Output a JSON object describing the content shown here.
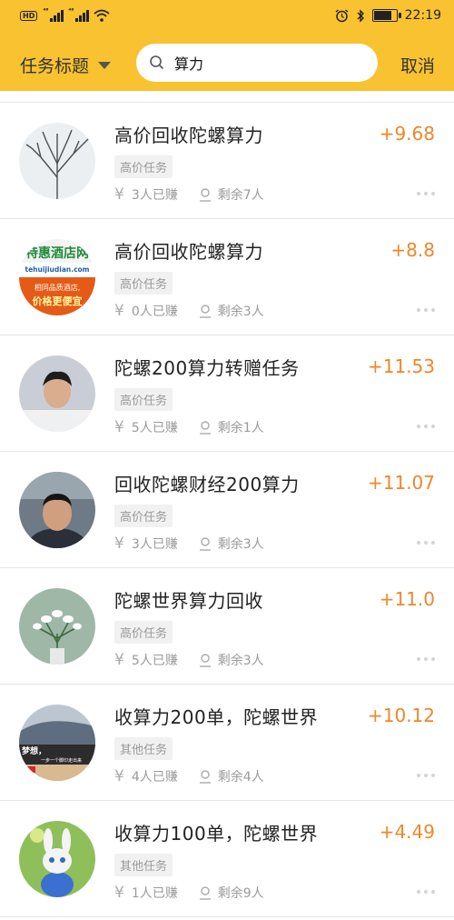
{
  "statusbar": {
    "left_icons": [
      "hd-icon",
      "signal-icon",
      "signal-icon",
      "wifi-icon"
    ],
    "time": "22:19",
    "signal1": "⁴⁶",
    "signal2": "⁴⁶",
    "hd": "HD"
  },
  "header": {
    "filter_label": "任务标题",
    "search_value": "算力",
    "cancel_label": "取消",
    "accent": "#f8c230"
  },
  "tasks": [
    {
      "title": "高价回收陀螺算力",
      "price": "+9.68",
      "tag": "高价任务",
      "earned": "3人已赚",
      "remaining": "剩余7人",
      "avatar": "tree"
    },
    {
      "title": "高价回收陀螺算力",
      "price": "+8.8",
      "tag": "高价任务",
      "earned": "0人已赚",
      "remaining": "剩余3人",
      "avatar": "hotel",
      "avatar_text": [
        "特惠酒店网",
        "tehuijiudian.com",
        "相同品质酒店,",
        "价格更便宜"
      ]
    },
    {
      "title": "陀螺200算力转赠任务",
      "price": "+11.53",
      "tag": "高价任务",
      "earned": "5人已赚",
      "remaining": "剩余1人",
      "avatar": "person1"
    },
    {
      "title": "回收陀螺财经200算力",
      "price": "+11.07",
      "tag": "高价任务",
      "earned": "3人已赚",
      "remaining": "剩余3人",
      "avatar": "person2"
    },
    {
      "title": "陀螺世界算力回收",
      "price": "+11.0",
      "tag": "高价任务",
      "earned": "5人已赚",
      "remaining": "剩余3人",
      "avatar": "flowers"
    },
    {
      "title": "收算力200单，陀螺世界",
      "price": "+10.12",
      "tag": "其他任务",
      "earned": "4人已赚",
      "remaining": "剩余4人",
      "avatar": "sky",
      "avatar_text": [
        "梦想，",
        "一步一个脚印走出来"
      ]
    },
    {
      "title": "收算力100单，陀螺世界",
      "price": "+4.49",
      "tag": "其他任务",
      "earned": "1人已赚",
      "remaining": "剩余9人",
      "avatar": "cat"
    }
  ],
  "colors": {
    "price": "#f0862a",
    "tag_bg": "#f1f1f1",
    "muted": "#9a9a9a"
  }
}
